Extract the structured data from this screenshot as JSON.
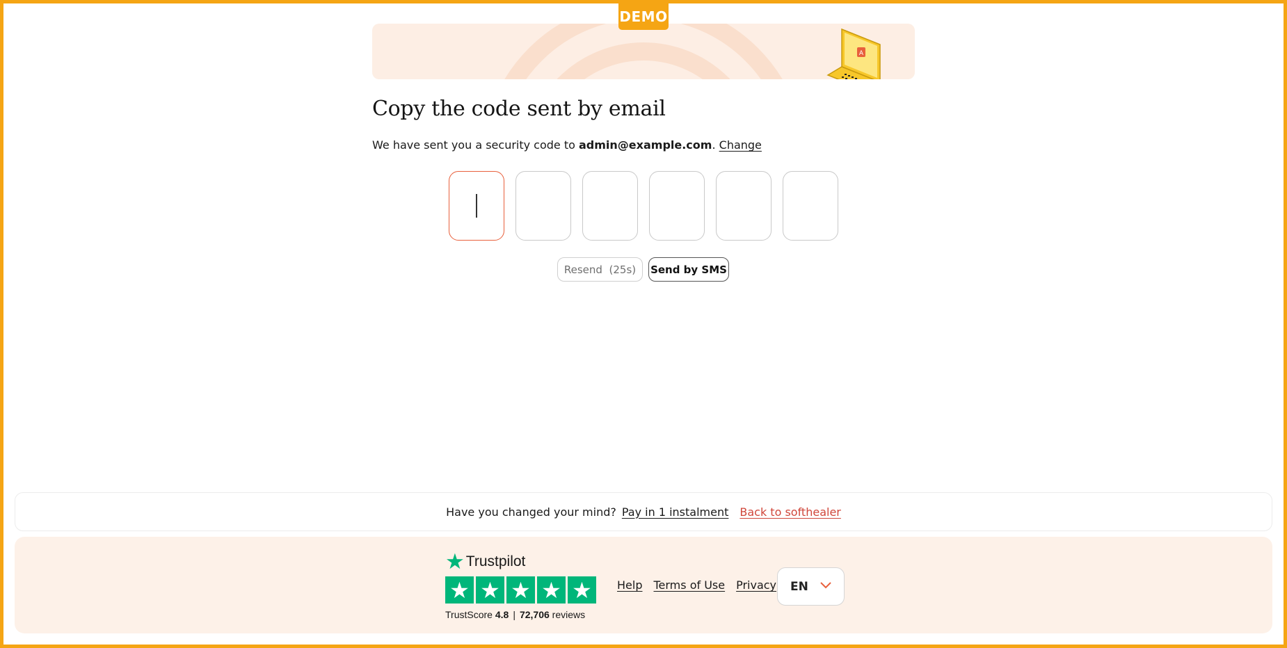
{
  "demo_badge": "DEMO",
  "heading": "Copy the code sent by email",
  "subtitle": {
    "prefix": "We have sent you a security code to ",
    "email": "admin@example.com",
    "period": ".",
    "change_link": "Change"
  },
  "code_inputs": [
    "",
    "",
    "",
    "",
    "",
    ""
  ],
  "actions": {
    "resend_label": "Resend",
    "resend_timer": "(25s)",
    "sms_label": "Send by SMS"
  },
  "mind_bar": {
    "question": "Have you changed your mind?",
    "pay_link": "Pay in 1 instalment",
    "back_link": "Back to softhealer"
  },
  "trustpilot": {
    "brand": "Trustpilot",
    "score_label": "TrustScore",
    "score": "4.8",
    "separator": "|",
    "reviews_count": "72,706",
    "reviews_label": "reviews",
    "stars": 5
  },
  "footer_links": {
    "help": "Help",
    "terms": "Terms of Use",
    "privacy": "Privacy"
  },
  "language": "EN",
  "colors": {
    "frame": "#f5a514",
    "accent_orange": "#e8603c",
    "back_link_red": "#d0463a",
    "trustpilot_green": "#00b67a",
    "footer_bg": "#fdf1e8"
  },
  "icons": {
    "banner_illustration": "laptop-lock-icon",
    "trustpilot_star": "star-icon",
    "language_chevron": "chevron-down-icon"
  }
}
